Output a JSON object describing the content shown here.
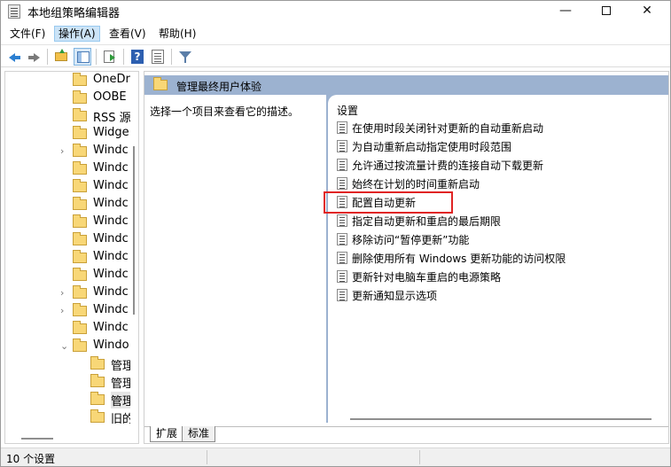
{
  "window": {
    "title": "本地组策略编辑器",
    "minimize_glyph": "—",
    "close_glyph": "✕"
  },
  "menu": {
    "items": [
      "文件(F)",
      "操作(A)",
      "查看(V)",
      "帮助(H)"
    ],
    "active_index": 1
  },
  "tree": {
    "items": [
      {
        "label": "OneDr",
        "expandable": false,
        "depth": 0
      },
      {
        "label": "OOBE",
        "expandable": false,
        "depth": 0
      },
      {
        "label": "RSS 源",
        "expandable": false,
        "depth": 0
      },
      {
        "label": "Widge",
        "expandable": false,
        "depth": 0
      },
      {
        "label": "Windc",
        "expandable": true,
        "depth": 0
      },
      {
        "label": "Windc",
        "expandable": false,
        "depth": 0
      },
      {
        "label": "Windc",
        "expandable": false,
        "depth": 0
      },
      {
        "label": "Windc",
        "expandable": false,
        "depth": 0
      },
      {
        "label": "Windc",
        "expandable": false,
        "depth": 0
      },
      {
        "label": "Windc",
        "expandable": false,
        "depth": 0
      },
      {
        "label": "Windc",
        "expandable": false,
        "depth": 0
      },
      {
        "label": "Windc",
        "expandable": false,
        "depth": 0
      },
      {
        "label": "Windc",
        "expandable": true,
        "depth": 0
      },
      {
        "label": "Windc",
        "expandable": true,
        "depth": 0
      },
      {
        "label": "Windc",
        "expandable": false,
        "depth": 0
      },
      {
        "label": "Windo",
        "expandable": true,
        "expanded": true,
        "depth": 0
      },
      {
        "label": "管理",
        "expandable": false,
        "depth": 1
      },
      {
        "label": "管理",
        "expandable": false,
        "depth": 1
      },
      {
        "label": "管理",
        "expandable": false,
        "depth": 1,
        "selected": true
      },
      {
        "label": "旧的",
        "expandable": false,
        "depth": 1
      }
    ]
  },
  "right_pane": {
    "header_title": "管理最终用户体验",
    "description": "选择一个项目来查看它的描述。",
    "list_title": "设置",
    "settings": [
      "在使用时段关闭针对更新的自动重新启动",
      "为自动重新启动指定使用时段范围",
      "允许通过按流量计费的连接自动下载更新",
      "始终在计划的时间重新启动",
      "配置自动更新",
      "指定自动更新和重启的最后期限",
      "移除访问“暂停更新”功能",
      "删除使用所有 Windows 更新功能的访问权限",
      "更新针对电脑车重启的电源策略",
      "更新通知显示选项"
    ],
    "highlighted_index": 4,
    "highlight_color": "#e02424",
    "header_bg": "#9cb2d0"
  },
  "tabs": {
    "items": [
      "扩展",
      "标准"
    ],
    "active_index": 0
  },
  "status": {
    "text": "10 个设置"
  }
}
